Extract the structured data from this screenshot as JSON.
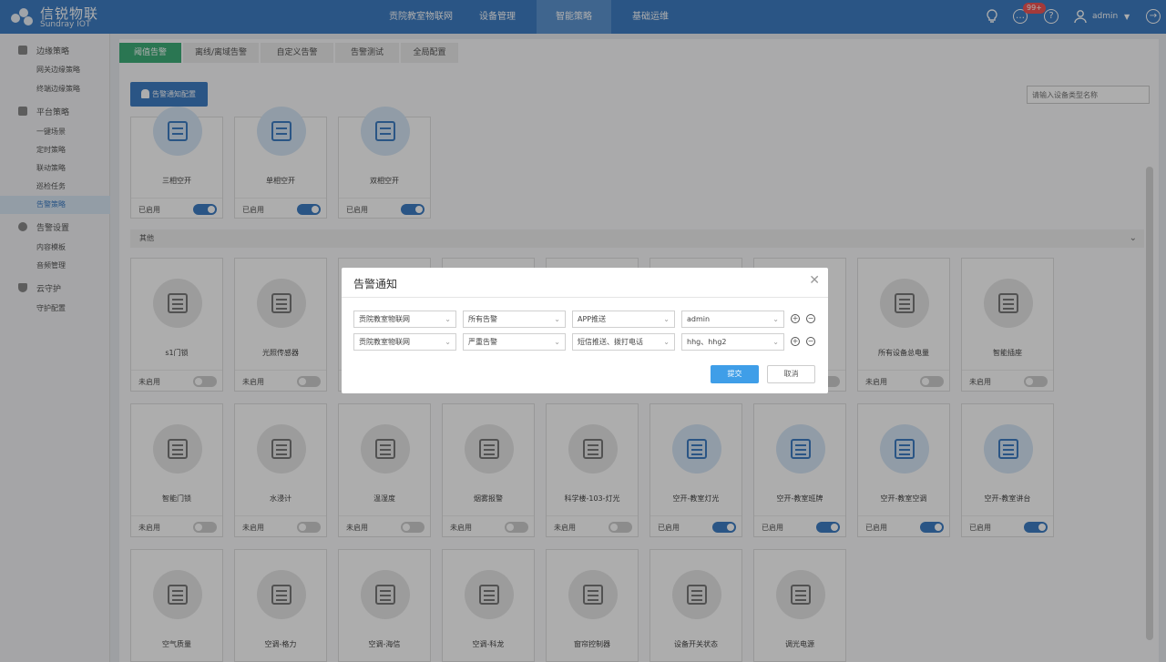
{
  "app": {
    "title": "信锐物联",
    "subtitle": "Sundray IOT"
  },
  "nav": [
    {
      "label": "贡院教室物联网"
    },
    {
      "label": "设备管理"
    },
    {
      "label": "智能策略"
    },
    {
      "label": "基础运维"
    }
  ],
  "header": {
    "badge": "99+",
    "user": "admin"
  },
  "sidebar": {
    "groups": [
      {
        "label": "边缘策略",
        "items": [
          "网关边缘策略",
          "终端边缘策略"
        ]
      },
      {
        "label": "平台策略",
        "items": [
          "一键场景",
          "定时策略",
          "联动策略",
          "巡检任务",
          "告警策略"
        ]
      },
      {
        "label": "告警设置",
        "items": [
          "内容模板",
          "音频管理"
        ]
      },
      {
        "label": "云守护",
        "items": [
          "守护配置"
        ]
      }
    ]
  },
  "tabs": [
    "阈值告警",
    "离线/离域告警",
    "自定义告警",
    "告警测试",
    "全局配置"
  ],
  "toolbar": {
    "notify_button": "告警通知配置",
    "search_placeholder": "请输入设备类型名称"
  },
  "section": {
    "other_label": "其他"
  },
  "cards_top": [
    {
      "name": "三相空开",
      "state": "已启用",
      "on": true
    },
    {
      "name": "单相空开",
      "state": "已启用",
      "on": true
    },
    {
      "name": "双相空开",
      "state": "已启用",
      "on": true
    }
  ],
  "cards_row1": [
    {
      "name": "s1门锁",
      "state": "未启用",
      "on": false
    },
    {
      "name": "光照传感器",
      "state": "未启用",
      "on": false
    },
    {
      "name": "",
      "state": "",
      "on": false
    },
    {
      "name": "",
      "state": "",
      "on": false
    },
    {
      "name": "",
      "state": "",
      "on": false
    },
    {
      "name": "",
      "state": "",
      "on": false
    },
    {
      "name": "",
      "state": "",
      "on": false
    },
    {
      "name": "所有设备总电量",
      "state": "未启用",
      "on": false
    },
    {
      "name": "智能插座",
      "state": "未启用",
      "on": false
    }
  ],
  "cards_row2": [
    {
      "name": "智能门锁",
      "state": "未启用",
      "on": false
    },
    {
      "name": "水浸计",
      "state": "未启用",
      "on": false
    },
    {
      "name": "温湿度",
      "state": "未启用",
      "on": false
    },
    {
      "name": "烟雾报警",
      "state": "未启用",
      "on": false
    },
    {
      "name": "科学楼-103-灯光",
      "state": "未启用",
      "on": false
    },
    {
      "name": "空开-教室灯光",
      "state": "已启用",
      "on": true
    },
    {
      "name": "空开-教室班牌",
      "state": "已启用",
      "on": true
    },
    {
      "name": "空开-教室空调",
      "state": "已启用",
      "on": true
    },
    {
      "name": "空开-教室讲台",
      "state": "已启用",
      "on": true
    }
  ],
  "cards_row3": [
    {
      "name": "空气质量"
    },
    {
      "name": "空调-格力"
    },
    {
      "name": "空调-海信"
    },
    {
      "name": "空调-科龙"
    },
    {
      "name": "窗帘控制器"
    },
    {
      "name": "设备开关状态"
    },
    {
      "name": "调光电源"
    }
  ],
  "dialog": {
    "title": "告警通知",
    "rows": [
      {
        "project": "贡院教室物联网",
        "level": "所有告警",
        "method": "APP推送",
        "receiver": "admin"
      },
      {
        "project": "贡院教室物联网",
        "level": "严重告警",
        "method": "短信推送、拨打电话",
        "receiver": "hhg、hhg2"
      }
    ],
    "submit": "提交",
    "cancel": "取消"
  }
}
